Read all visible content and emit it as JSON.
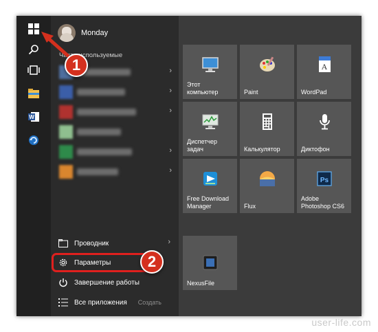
{
  "user": {
    "name": "Monday"
  },
  "list": {
    "section_title": "Часто используемые",
    "blurred_items": [
      {
        "colors": [
          "#4f6f9f",
          "#7a7a7a"
        ]
      },
      {
        "colors": [
          "#3b5ea8",
          "#9aa8c0"
        ]
      },
      {
        "colors": [
          "#b0322f",
          "#9a4a48"
        ]
      },
      {
        "colors": [
          "#6f9f6f",
          "#a8c0a8"
        ]
      },
      {
        "colors": [
          "#2e8a4a",
          "#7fb38a"
        ]
      },
      {
        "colors": [
          "#d9862e",
          "#e0b070"
        ]
      }
    ],
    "bottom": {
      "explorer": "Проводник",
      "settings": "Параметры",
      "shutdown": "Завершение работы",
      "all_apps": "Все приложения",
      "create": "Создать"
    }
  },
  "tiles": [
    {
      "label": "Этот\nкомпьютер",
      "icon": "computer-icon"
    },
    {
      "label": "Paint",
      "icon": "paint-palette-icon"
    },
    {
      "label": "WordPad",
      "icon": "wordpad-icon"
    },
    {
      "label": "Диспетчер\nзадач",
      "icon": "task-manager-icon"
    },
    {
      "label": "Калькулятор",
      "icon": "calculator-icon"
    },
    {
      "label": "Диктофон",
      "icon": "microphone-icon"
    },
    {
      "label": "Free Download\nManager",
      "icon": "fdm-icon"
    },
    {
      "label": "Flux",
      "icon": "flux-icon"
    },
    {
      "label": "Adobe\nPhotoshop CS6",
      "icon": "photoshop-icon"
    },
    {
      "label": "NexusFile",
      "icon": "nexusfile-icon"
    }
  ],
  "badges": {
    "one": "1",
    "two": "2"
  },
  "watermark": "user-life.com",
  "colors": {
    "badge": "#d4301e",
    "highlight": "#e0201e",
    "tile": "#565656",
    "panel": "#2b2b2b"
  }
}
